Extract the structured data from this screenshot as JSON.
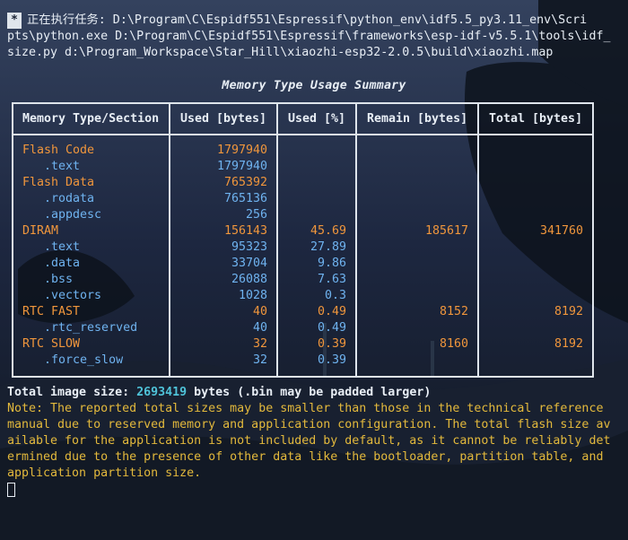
{
  "terminal": {
    "badge": "*",
    "command_lines": [
      "正在执行任务: D:\\Program\\C\\Espidf551\\Espressif\\python_env\\idf5.5_py3.11_env\\Scri",
      "pts\\python.exe D:\\Program\\C\\Espidf551\\Espressif\\frameworks\\esp-idf-v5.5.1\\tools\\idf_",
      "size.py d:\\Program_Workspace\\Star_Hill\\xiaozhi-esp32-2.0.5\\build\\xiaozhi.map"
    ]
  },
  "table": {
    "title": "Memory Type Usage Summary",
    "headers": [
      "Memory Type/Section",
      "Used [bytes]",
      "Used [%]",
      "Remain [bytes]",
      "Total [bytes]"
    ],
    "rows": [
      {
        "name": "Flash Code",
        "used": "1797940",
        "pct": "",
        "remain": "",
        "total": "",
        "kind": "type"
      },
      {
        "name": "   .text",
        "used": "1797940",
        "pct": "",
        "remain": "",
        "total": "",
        "kind": "section"
      },
      {
        "name": "Flash Data",
        "used": "765392",
        "pct": "",
        "remain": "",
        "total": "",
        "kind": "type"
      },
      {
        "name": "   .rodata",
        "used": "765136",
        "pct": "",
        "remain": "",
        "total": "",
        "kind": "section"
      },
      {
        "name": "   .appdesc",
        "used": "256",
        "pct": "",
        "remain": "",
        "total": "",
        "kind": "section"
      },
      {
        "name": "DIRAM",
        "used": "156143",
        "pct": "45.69",
        "remain": "185617",
        "total": "341760",
        "kind": "type"
      },
      {
        "name": "   .text",
        "used": "95323",
        "pct": "27.89",
        "remain": "",
        "total": "",
        "kind": "section"
      },
      {
        "name": "   .data",
        "used": "33704",
        "pct": "9.86",
        "remain": "",
        "total": "",
        "kind": "section"
      },
      {
        "name": "   .bss",
        "used": "26088",
        "pct": "7.63",
        "remain": "",
        "total": "",
        "kind": "section"
      },
      {
        "name": "   .vectors",
        "used": "1028",
        "pct": "0.3",
        "remain": "",
        "total": "",
        "kind": "section"
      },
      {
        "name": "RTC FAST",
        "used": "40",
        "pct": "0.49",
        "remain": "8152",
        "total": "8192",
        "kind": "type"
      },
      {
        "name": "   .rtc_reserved",
        "used": "40",
        "pct": "0.49",
        "remain": "",
        "total": "",
        "kind": "section"
      },
      {
        "name": "RTC SLOW",
        "used": "32",
        "pct": "0.39",
        "remain": "8160",
        "total": "8192",
        "kind": "type"
      },
      {
        "name": "   .force_slow",
        "used": "32",
        "pct": "0.39",
        "remain": "",
        "total": "",
        "kind": "section"
      }
    ]
  },
  "summary": {
    "total_prefix": "Total image size: ",
    "total_value": "2693419",
    "total_suffix": " bytes (.bin may be padded larger)",
    "note_lines": [
      "Note: The reported total sizes may be smaller than those in the technical reference",
      "manual due to reserved memory and application configuration. The total flash size av",
      "ailable for the application is not included by default, as it cannot be reliably det",
      "ermined due to the presence of other data like the bootloader, partition table, and",
      "application partition size."
    ]
  },
  "colors": {
    "type_row": "#f0963c",
    "section_row": "#6fb3f0",
    "total_value": "#4fc3d9",
    "note": "#e3b93c"
  }
}
